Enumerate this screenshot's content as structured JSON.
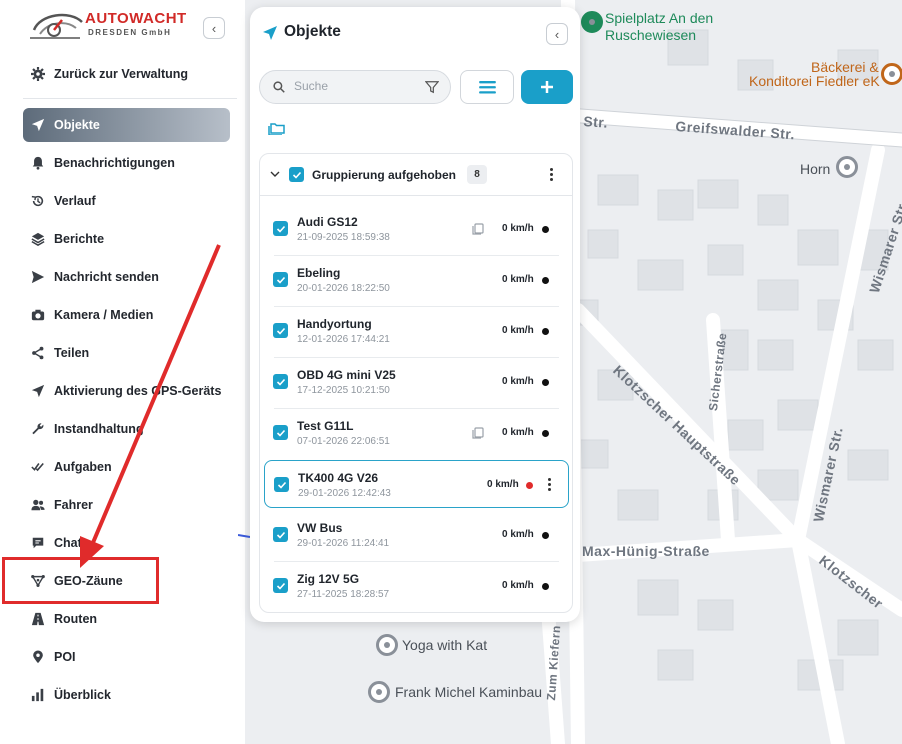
{
  "brand": {
    "name": "AUTOWACHT",
    "subtitle": "DRESDEN GmbH"
  },
  "sidebar": {
    "back_label": "Zurück zur Verwaltung",
    "items": [
      {
        "label": "Objekte",
        "icon": "navigation-arrow-icon",
        "active": true
      },
      {
        "label": "Benachrichtigungen",
        "icon": "bell-icon"
      },
      {
        "label": "Verlauf",
        "icon": "history-icon"
      },
      {
        "label": "Berichte",
        "icon": "layers-icon"
      },
      {
        "label": "Nachricht senden",
        "icon": "send-icon"
      },
      {
        "label": "Kamera / Medien",
        "icon": "camera-icon"
      },
      {
        "label": "Teilen",
        "icon": "share-icon"
      },
      {
        "label": "Aktivierung des GPS-Geräts",
        "icon": "navigation-arrow-icon"
      },
      {
        "label": "Instandhaltung",
        "icon": "wrench-icon"
      },
      {
        "label": "Aufgaben",
        "icon": "double-check-icon"
      },
      {
        "label": "Fahrer",
        "icon": "users-icon"
      },
      {
        "label": "Chat",
        "icon": "chat-icon"
      },
      {
        "label": "GEO-Zäune",
        "icon": "geofence-icon"
      },
      {
        "label": "Routen",
        "icon": "road-icon"
      },
      {
        "label": "POI",
        "icon": "map-pin-icon"
      },
      {
        "label": "Überblick",
        "icon": "bar-chart-icon"
      }
    ]
  },
  "panel": {
    "title": "Objekte",
    "search_placeholder": "Suche",
    "group": {
      "label": "Gruppierung aufgehoben",
      "count": "8"
    },
    "objects": [
      {
        "name": "Audi GS12",
        "time": "21-09-2025 18:59:38",
        "speed": "0 km/h",
        "status": "offline",
        "device_icon": true
      },
      {
        "name": "Ebeling",
        "time": "20-01-2026 18:22:50",
        "speed": "0 km/h",
        "status": "offline"
      },
      {
        "name": "Handyortung",
        "time": "12-01-2026 17:44:21",
        "speed": "0 km/h",
        "status": "offline"
      },
      {
        "name": "OBD 4G mini V25",
        "time": "17-12-2025 10:21:50",
        "speed": "0 km/h",
        "status": "offline"
      },
      {
        "name": "Test G11L",
        "time": "07-01-2026 22:06:51",
        "speed": "0 km/h",
        "status": "offline",
        "device_icon": true
      },
      {
        "name": "TK400 4G V26",
        "time": "29-01-2026 12:42:43",
        "speed": "0 km/h",
        "status": "alert",
        "selected": true
      },
      {
        "name": "VW Bus",
        "time": "29-01-2026 11:24:41",
        "speed": "0 km/h",
        "status": "offline"
      },
      {
        "name": "Zig 12V 5G",
        "time": "27-11-2025 18:28:57",
        "speed": "0 km/h",
        "status": "offline"
      }
    ]
  },
  "map": {
    "streets": [
      "Greifswalder Str.",
      "Wismarer Str.",
      "Wismarer Str.",
      "Klotzscher Hauptstraße",
      "Sicherstraße",
      "Max-Hünig-Straße",
      "Klotzscher",
      "Zum Kiefern",
      "Str."
    ],
    "pois": [
      {
        "name": "Spielplatz An den Ruschewiesen",
        "line1": "Spielplatz An den",
        "line2": "Ruschewiesen",
        "color": "#1e8a5a"
      },
      {
        "name": "Bäckerei & Konditorei Fiedler eK",
        "line1": "Bäckerei &",
        "line2": "Konditorei Fiedler eK",
        "color": "#c0661a"
      },
      {
        "name": "Horn",
        "color": "#4a5058"
      },
      {
        "name": "Yoga with Kat",
        "color": "#4a5058"
      },
      {
        "name": "Frank Michel Kaminbau",
        "color": "#4a5058"
      }
    ]
  },
  "colors": {
    "accent": "#1a9fc9",
    "annotation": "#e02b2b",
    "active_gradient_start": "#5d6b7a"
  }
}
